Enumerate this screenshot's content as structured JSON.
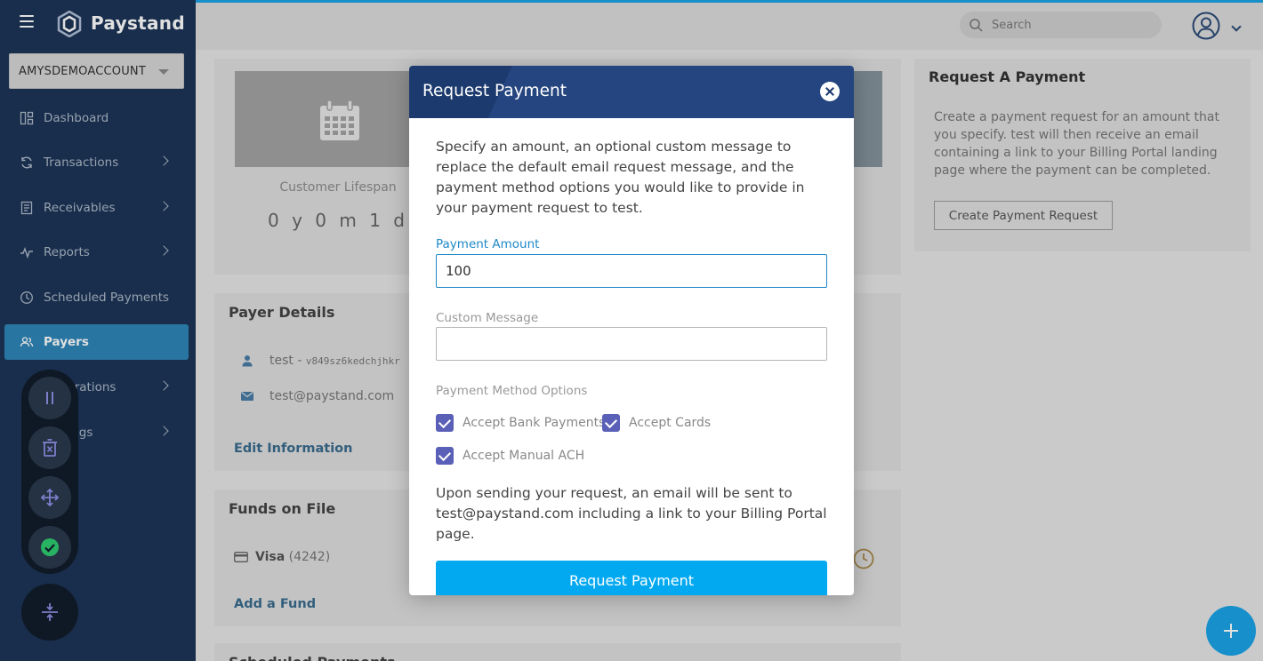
{
  "app": {
    "brand": "Paystand",
    "account_name": "AMYSDEMOACCOUNT"
  },
  "sidebar": {
    "items": [
      {
        "label": "Dashboard",
        "icon": "dashboard-icon",
        "has_submenu": false
      },
      {
        "label": "Transactions",
        "icon": "transactions-icon",
        "has_submenu": true
      },
      {
        "label": "Receivables",
        "icon": "receivables-icon",
        "has_submenu": true
      },
      {
        "label": "Reports",
        "icon": "reports-icon",
        "has_submenu": true
      },
      {
        "label": "Scheduled Payments",
        "icon": "clock-icon",
        "has_submenu": false
      },
      {
        "label": "Payers",
        "icon": "users-icon",
        "has_submenu": false,
        "active": true
      },
      {
        "label": "Integrations",
        "icon": "integrations-icon",
        "has_submenu": true
      },
      {
        "label": "Settings",
        "icon": "settings-icon",
        "has_submenu": true
      }
    ]
  },
  "header": {
    "search_placeholder": "Search"
  },
  "lifespan": {
    "label": "Customer Lifespan",
    "value": "0 y 0 m 1 d"
  },
  "payer_details": {
    "title": "Payer Details",
    "name": "test - ",
    "code": "v849sz6kedchjhkr",
    "email": "test@paystand.com",
    "edit_link": "Edit Information"
  },
  "funds": {
    "title": "Funds on File",
    "brand": "Visa",
    "last4": "(4242)",
    "add_link": "Add a Fund"
  },
  "scheduled": {
    "title": "Scheduled Payments"
  },
  "request_card": {
    "title": "Request A Payment",
    "description": "Create a payment request for an amount that you specify. test will then receive an email containing a link to your Billing Portal landing page where the payment can be completed.",
    "button": "Create Payment Request"
  },
  "modal": {
    "title": "Request Payment",
    "intro": "Specify an amount, an optional custom message to replace the default email request message, and the payment method options you would like to provide in your payment request to test.",
    "amount_label": "Payment Amount",
    "amount_value": "100",
    "message_label": "Custom Message",
    "message_value": "",
    "options_label": "Payment Method Options",
    "options": [
      {
        "label": "Accept Bank Payments",
        "checked": true
      },
      {
        "label": "Accept Cards",
        "checked": true
      },
      {
        "label": "Accept Manual ACH",
        "checked": true
      }
    ],
    "outro": "Upon sending your request, an email will be sent to test@paystand.com including a link to your Billing Portal page.",
    "submit": "Request Payment"
  },
  "colors": {
    "sidebar": "#1c3557",
    "accent": "#1aa3e8",
    "modal_header": "#1d3a6e",
    "checkbox": "#5a5fb8",
    "active_nav": "#2f86b8"
  }
}
